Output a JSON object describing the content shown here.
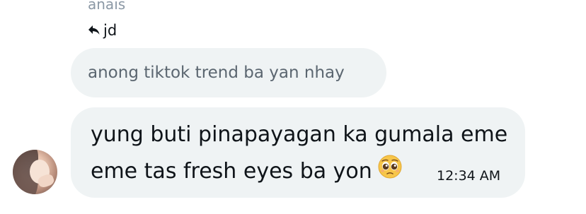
{
  "quoted": {
    "sender": "anaïs",
    "reply_to_name": "jd",
    "text": "anong tiktok trend ba yan nhay"
  },
  "message": {
    "line1": "yung buti pinapayagan ka gumala eme",
    "line2": "eme tas fresh eyes ba yon",
    "emoji": "pleading-face-icon",
    "timestamp": "12:34 AM"
  },
  "colors": {
    "bubble_bg": "#eff3f4",
    "text_primary": "#0f1419",
    "text_muted": "#5b6670",
    "sender_muted": "#8b98a5"
  }
}
